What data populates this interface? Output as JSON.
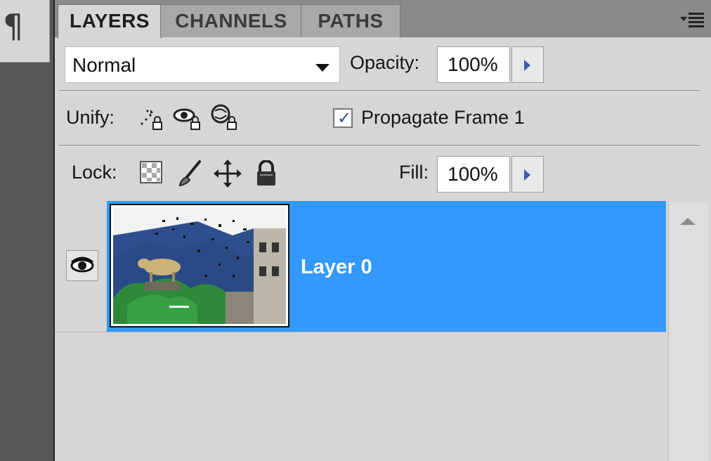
{
  "left_dock": {
    "paragraph_glyph": "¶"
  },
  "tabs": [
    {
      "label": "LAYERS",
      "active": true
    },
    {
      "label": "CHANNELS",
      "active": false
    },
    {
      "label": "PATHS",
      "active": false
    }
  ],
  "blend": {
    "mode": "Normal",
    "opacity_label": "Opacity:",
    "opacity_value": "100%"
  },
  "unify": {
    "label": "Unify:",
    "propagate_label": "Propagate Frame 1",
    "propagate_checked": true,
    "check_glyph": "✓"
  },
  "lock": {
    "label": "Lock:",
    "fill_label": "Fill:",
    "fill_value": "100%"
  },
  "layers": [
    {
      "name": "Layer 0",
      "visible": true,
      "selected": true
    }
  ],
  "colors": {
    "selection": "#3399ff",
    "panel_bg": "#d6d6d6"
  }
}
